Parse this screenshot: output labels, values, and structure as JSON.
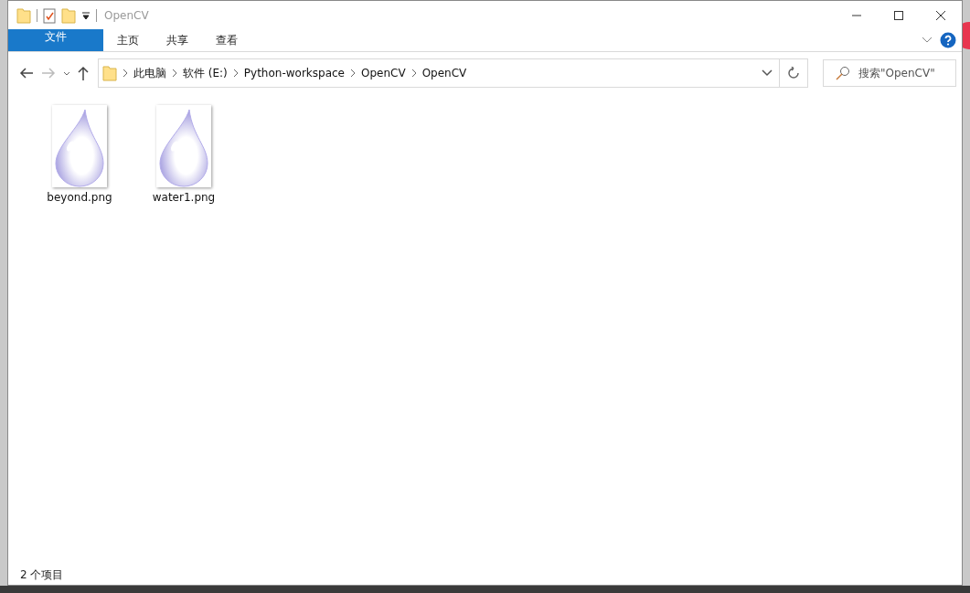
{
  "window": {
    "title": "OpenCV"
  },
  "ribbon_tabs": [
    {
      "label": "文件",
      "kind": "file"
    },
    {
      "label": "主页",
      "kind": "tab"
    },
    {
      "label": "共享",
      "kind": "tab"
    },
    {
      "label": "查看",
      "kind": "tab"
    }
  ],
  "breadcrumbs": [
    "此电脑",
    "软件 (E:)",
    "Python-workspace",
    "OpenCV",
    "OpenCV"
  ],
  "search": {
    "placeholder": "搜索\"OpenCV\""
  },
  "files": [
    {
      "name": "beyond.png"
    },
    {
      "name": "water1.png"
    }
  ],
  "status_bar": {
    "item_count": "2 个项目"
  }
}
